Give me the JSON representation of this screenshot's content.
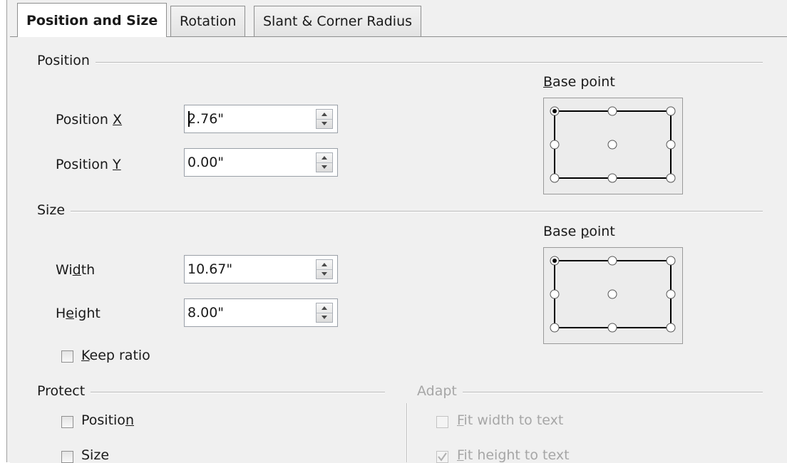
{
  "tabs": [
    {
      "label": "Position and Size",
      "active": true
    },
    {
      "label": "Rotation",
      "active": false
    },
    {
      "label": "Slant & Corner Radius",
      "active": false
    }
  ],
  "position": {
    "heading": "Position",
    "x_label_pre": "Position ",
    "x_label_key": "X",
    "x_value": "2.76\"",
    "y_label_pre": "Position ",
    "y_label_key": "Y",
    "y_value": "0.00\"",
    "base_point_key": "B",
    "base_point_rest": "ase point",
    "base_point_selected": "top-left"
  },
  "size": {
    "heading": "Size",
    "width_pre": "Wi",
    "width_key": "d",
    "width_post": "th",
    "width_value": "10.67\"",
    "height_pre": "H",
    "height_key": "e",
    "height_post": "ight",
    "height_value": "8.00\"",
    "keep_ratio_key": "K",
    "keep_ratio_rest": "eep ratio",
    "keep_ratio_checked": false,
    "base_point_pre": "Base ",
    "base_point_key": "p",
    "base_point_post": "oint",
    "base_point_selected": "top-left"
  },
  "protect": {
    "heading": "Protect",
    "position_pre": "Positio",
    "position_key": "n",
    "position_checked": false,
    "size_label": "Size",
    "size_checked": false
  },
  "adapt": {
    "heading": "Adapt",
    "fit_width_key": "F",
    "fit_width_rest": "it width to text",
    "fit_width_checked": false,
    "fit_height_key": "F",
    "fit_height_rest": "it height to text",
    "fit_height_checked": true
  },
  "colors": {
    "panel_bg": "#f0f0f0",
    "disabled_text": "#a6a6a6",
    "tab_border": "#8e8f8f"
  }
}
